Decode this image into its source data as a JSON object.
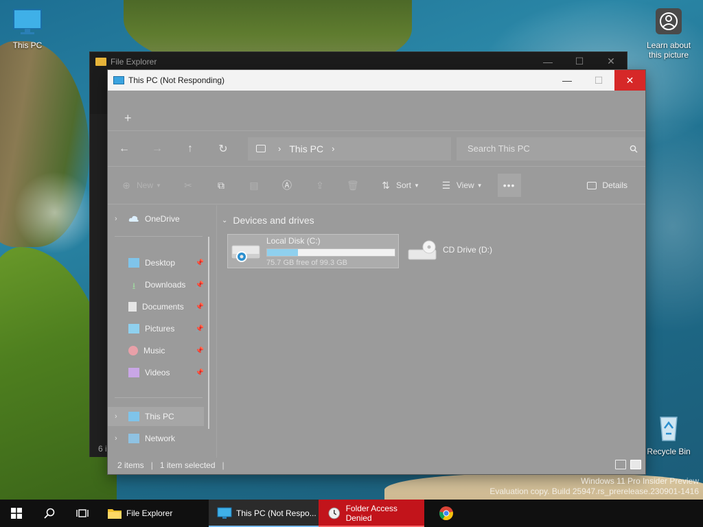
{
  "desktop": {
    "icons": {
      "this_pc": "This PC",
      "learn_line1": "Learn about",
      "learn_line2": "this picture",
      "recycle_bin": "Recycle Bin"
    },
    "watermark": {
      "line1": "Windows 11 Pro Insider Preview",
      "line2": "Evaluation copy. Build 25947.rs_prerelease.230901-1416"
    }
  },
  "background_window": {
    "title": "File Explorer",
    "status": "6 i"
  },
  "window": {
    "title": "This PC (Not Responding)",
    "controls": {
      "minimize": "—",
      "maximize": "☐",
      "close": "✕"
    },
    "tabbar": {
      "new_tab": "+"
    },
    "address": {
      "location": "This PC",
      "search_placeholder": "Search This PC"
    },
    "toolbar": {
      "new_label": "New",
      "sort_label": "Sort",
      "view_label": "View",
      "more_label": "•••",
      "details_label": "Details"
    },
    "nav": {
      "onedrive": "OneDrive",
      "desktop": "Desktop",
      "downloads": "Downloads",
      "documents": "Documents",
      "pictures": "Pictures",
      "music": "Music",
      "videos": "Videos",
      "this_pc": "This PC",
      "network": "Network"
    },
    "content": {
      "group_title": "Devices and drives",
      "drives": [
        {
          "name": "Local Disk (C:)",
          "free": "75.7 GB free of 99.3 GB",
          "used_fraction": 0.24
        },
        {
          "name": "CD Drive (D:)"
        }
      ]
    },
    "status": {
      "items": "2 items",
      "selected": "1 item selected"
    }
  },
  "taskbar": {
    "tasks": [
      {
        "label": "File Explorer"
      },
      {
        "label": "This PC (Not Respo..."
      },
      {
        "label": "Folder Access Denied"
      }
    ]
  },
  "colors": {
    "accent": "#76b9ed",
    "close_red": "#d62828",
    "alert_red": "#c2141b"
  }
}
